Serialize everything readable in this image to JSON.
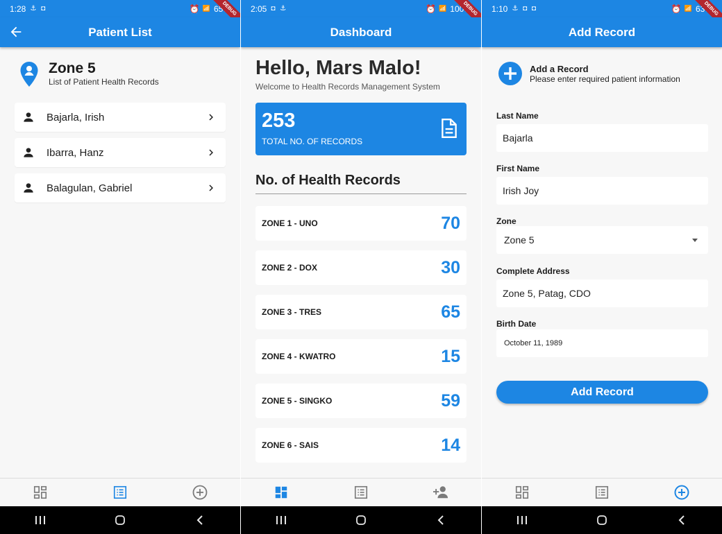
{
  "colors": {
    "primary": "#1d86e3",
    "inactive_icon": "#7a7a7a",
    "system_nav": "#000000"
  },
  "screens": [
    {
      "status": {
        "time": "1:28",
        "battery": "65%",
        "debug": "DEBUG"
      },
      "title": "Patient List",
      "zone_title": "Zone 5",
      "zone_subtitle": "List of Patient Health Records",
      "patients": [
        {
          "name": "Bajarla, Irish"
        },
        {
          "name": "Ibarra, Hanz"
        },
        {
          "name": "Balagulan, Gabriel"
        }
      ],
      "bottom_nav": [
        "dashboard-icon",
        "list-icon",
        "add-circle-icon"
      ],
      "active_tab": 1
    },
    {
      "status": {
        "time": "2:05",
        "battery": "100%",
        "debug": "DEBUG"
      },
      "title": "Dashboard",
      "greeting": "Hello, Mars Malo!",
      "welcome": "Welcome to Health Records Management System",
      "total": {
        "value": "253",
        "label": "TOTAL NO. OF RECORDS"
      },
      "section_title": "No. of Health Records",
      "zones": [
        {
          "label": "ZONE 1 - UNO",
          "count": "70"
        },
        {
          "label": "ZONE 2 - DOX",
          "count": "30"
        },
        {
          "label": "ZONE 3 - TRES",
          "count": "65"
        },
        {
          "label": "ZONE 4 - KWATRO",
          "count": "15"
        },
        {
          "label": "ZONE 5 - SINGKO",
          "count": "59"
        },
        {
          "label": "ZONE 6 - SAIS",
          "count": "14"
        }
      ],
      "bottom_nav": [
        "dashboard-icon",
        "list-icon",
        "person-add-icon"
      ],
      "active_tab": 0
    },
    {
      "status": {
        "time": "1:10",
        "battery": "63%",
        "debug": "DEBUG"
      },
      "title": "Add Record",
      "header_title": "Add a Record",
      "header_subtitle": "Please enter required patient information",
      "form": {
        "last_name_label": "Last Name",
        "last_name_value": "Bajarla",
        "first_name_label": "First Name",
        "first_name_value": "Irish Joy",
        "zone_label": "Zone",
        "zone_value": "Zone 5",
        "address_label": "Complete Address",
        "address_value": "Zone 5, Patag, CDO",
        "birth_label": "Birth Date",
        "birth_value": "October 11, 1989"
      },
      "submit_label": "Add Record",
      "bottom_nav": [
        "dashboard-icon",
        "list-icon",
        "add-circle-icon"
      ],
      "active_tab": 2
    }
  ]
}
